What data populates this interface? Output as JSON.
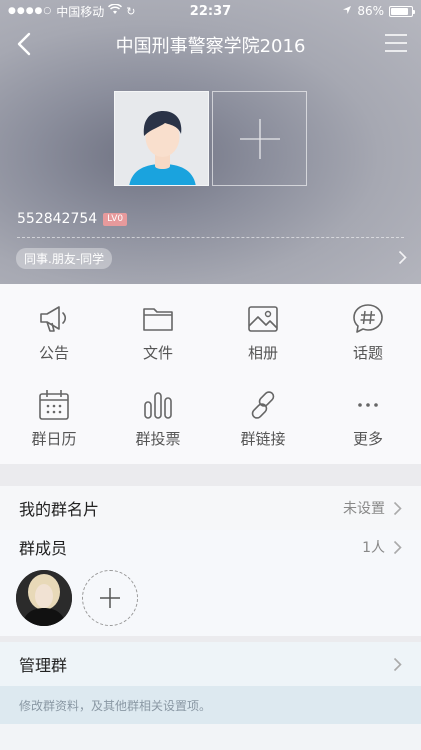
{
  "status_bar": {
    "signal_dots": "●●●●○",
    "carrier": "中国移动",
    "time": "22:37",
    "battery_text": "86%",
    "battery_level": 0.86
  },
  "nav": {
    "title": "中国刑事警察学院2016"
  },
  "group": {
    "id": "552842754",
    "level": "LV0",
    "tag": "同事.朋友-同学"
  },
  "actions": [
    {
      "label": "公告",
      "icon": "megaphone-icon"
    },
    {
      "label": "文件",
      "icon": "folder-icon"
    },
    {
      "label": "相册",
      "icon": "image-icon"
    },
    {
      "label": "话题",
      "icon": "hashtag-bubble-icon"
    },
    {
      "label": "群日历",
      "icon": "calendar-icon"
    },
    {
      "label": "群投票",
      "icon": "bar-chart-icon"
    },
    {
      "label": "群链接",
      "icon": "link-icon"
    },
    {
      "label": "更多",
      "icon": "more-dots-icon"
    }
  ],
  "card_row": {
    "label": "我的群名片",
    "value": "未设置"
  },
  "members_row": {
    "label": "群成员",
    "value": "1人"
  },
  "manage_row": {
    "label": "管理群"
  },
  "manage_hint": "修改群资料，及其他群相关设置项。",
  "colors": {
    "lv_badge": "#e79a9c",
    "accent_icon": "#666666"
  }
}
